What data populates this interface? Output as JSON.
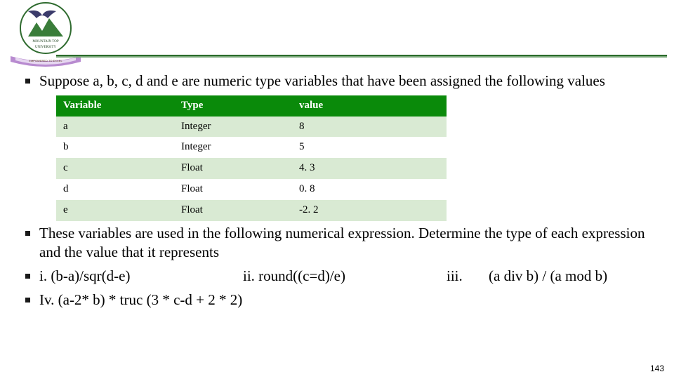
{
  "bullets": {
    "intro": "Suppose a, b, c, d and e are numeric type variables that have been assigned the following values",
    "after_table": "These variables are used in the following numerical expression. Determine the type of each expression and the value that it represents",
    "line3_i": "i. (b-a)/sqr(d-e)",
    "line3_ii": "ii. round((c=d)/e)",
    "line3_iii_label": "iii.",
    "line3_iii": "(a div b) / (a mod b)",
    "line4": "Iv. (a-2* b) * truc (3 * c-d + 2 * 2)"
  },
  "table": {
    "headers": {
      "variable": "Variable",
      "type": "Type",
      "value": "value"
    },
    "rows": [
      {
        "variable": "a",
        "type": "Integer",
        "value": "8"
      },
      {
        "variable": "b",
        "type": "Integer",
        "value": "5"
      },
      {
        "variable": "c",
        "type": "Float",
        "value": "4. 3"
      },
      {
        "variable": "d",
        "type": "Float",
        "value": "0. 8"
      },
      {
        "variable": "e",
        "type": "Float",
        "value": "-2. 2"
      }
    ]
  },
  "page_number": "143",
  "logo": {
    "text_top": "MOUNTAIN TOP",
    "text_bottom": "UNIVERSITY",
    "ribbon": "EMPOWERED TO EXCEL"
  }
}
